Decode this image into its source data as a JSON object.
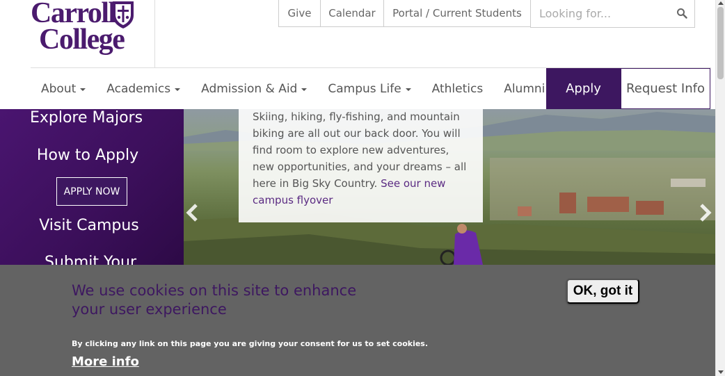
{
  "logo": {
    "line1": "Carroll",
    "line2": "College"
  },
  "utility": {
    "give": "Give",
    "calendar": "Calendar",
    "portal": "Portal / Current Students"
  },
  "search": {
    "placeholder": "Looking for...",
    "icon": "search-icon"
  },
  "nav": {
    "items": [
      {
        "label": "About",
        "dropdown": true
      },
      {
        "label": "Academics",
        "dropdown": true
      },
      {
        "label": "Admission & Aid",
        "dropdown": true
      },
      {
        "label": "Campus Life",
        "dropdown": true
      },
      {
        "label": "Athletics",
        "dropdown": false
      },
      {
        "label": "Alumni",
        "dropdown": true
      }
    ],
    "apply": "Apply",
    "request_info": "Request Info"
  },
  "sidebar": {
    "explore": "Explore Majors",
    "how_to_apply": "How to Apply",
    "apply_now": "APPLY NOW",
    "visit": "Visit Campus",
    "submit": "Submit Your"
  },
  "hero": {
    "caption": "Skiing, hiking, fly-fishing, and mountain biking are all out our back door. You will find room to explore new adventures, new opportunities, and your dreams – all here in Big Sky Country.",
    "caption_link": "See our new campus flyover"
  },
  "cookie": {
    "title": "We use cookies on this site to enhance your user experience",
    "sub": "By clicking any link on this page you are giving your consent for us to set cookies.",
    "more": "More info",
    "ok": "OK, got it"
  },
  "colors": {
    "brand_purple": "#3d1760",
    "banner_gray": "#636363"
  }
}
